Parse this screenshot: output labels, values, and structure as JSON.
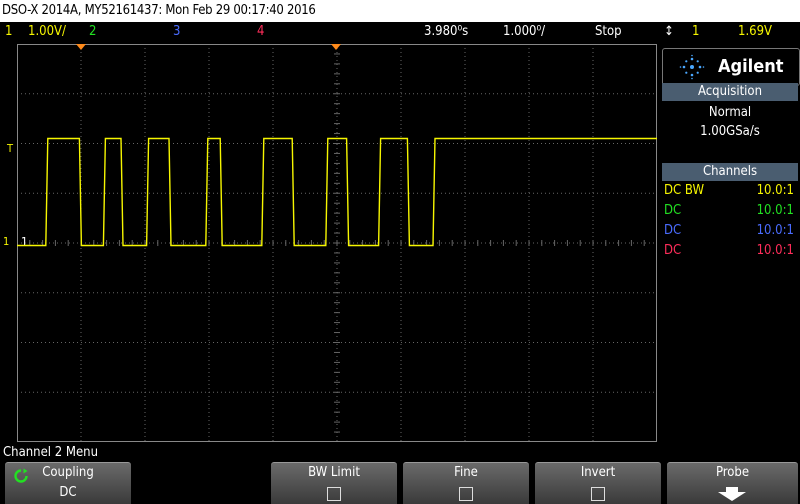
{
  "title": "DSO-X 2014A, MY52161437: Mon Feb 29 00:17:40 2016",
  "status": {
    "ch1_num": "1",
    "ch1_scale": "1.00V/",
    "ch2_num": "2",
    "ch3_num": "3",
    "ch4_num": "4",
    "time_offset": "3.980⁰s",
    "timebase": "1.000⁰/",
    "run_state": "Stop",
    "trigger_icon": "↕",
    "trigger_channel": "1",
    "trigger_level": "1.69V"
  },
  "panel": {
    "brand": "Agilent",
    "acquisition_header": "Acquisition",
    "acq_mode": "Normal",
    "acq_rate": "1.00GSa/s",
    "channels_header": "Channels",
    "channels": [
      {
        "coupling": "DC BW",
        "probe": "10.0:1",
        "color": "#f6f600"
      },
      {
        "coupling": "DC",
        "probe": "10.0:1",
        "color": "#22e022"
      },
      {
        "coupling": "DC",
        "probe": "10.0:1",
        "color": "#4a6cff"
      },
      {
        "coupling": "DC",
        "probe": "10.0:1",
        "color": "#ff2d5a"
      }
    ]
  },
  "markers": {
    "trigger_level": "T",
    "ch1_ground": "1"
  },
  "menu": {
    "title": "Channel 2 Menu",
    "coupling_label": "Coupling",
    "coupling_value": "DC",
    "bwlimit_label": "BW Limit",
    "fine_label": "Fine",
    "invert_label": "Invert",
    "probe_label": "Probe"
  },
  "trace": {
    "color": "#f6f600",
    "high_level_div": 2.1,
    "low_level_div": -0.05,
    "edges_div": [
      0.9,
      1.95,
      2.7,
      3.25,
      4.05,
      4.75,
      5.9,
      6.35,
      7.65,
      8.6,
      9.65,
      10.3,
      11.3,
      12.2,
      13.0
    ]
  }
}
